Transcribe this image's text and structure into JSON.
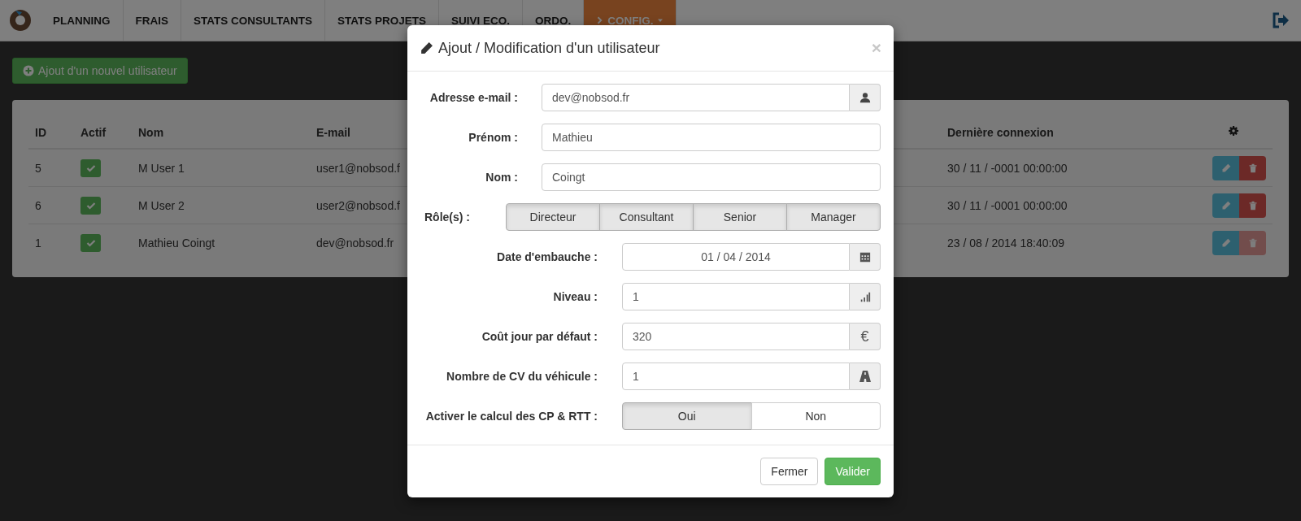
{
  "navbar": {
    "items": [
      {
        "label": "PLANNING",
        "selected": false,
        "dropdown": false
      },
      {
        "label": "FRAIS",
        "selected": false,
        "dropdown": false
      },
      {
        "label": "STATS CONSULTANTS",
        "selected": false,
        "dropdown": false
      },
      {
        "label": "STATS PROJETS",
        "selected": false,
        "dropdown": false
      },
      {
        "label": "SUIVI ECO.",
        "selected": false,
        "dropdown": false
      },
      {
        "label": "ORDO.",
        "selected": false,
        "dropdown": false
      },
      {
        "label": "CONFIG.",
        "selected": true,
        "dropdown": true
      }
    ]
  },
  "add_button": "Ajout d'un nouvel utilisateur",
  "table": {
    "columns": [
      "ID",
      "Actif",
      "Nom",
      "E-mail",
      "Dernière connexion"
    ],
    "rows": [
      {
        "id": "5",
        "active": true,
        "name": "M User 1",
        "email": "user1@nobsod.f",
        "last_login": "30 / 11 / -0001 00:00:00",
        "delete_disabled": false
      },
      {
        "id": "6",
        "active": true,
        "name": "M User 2",
        "email": "user2@nobsod.f",
        "last_login": "30 / 11 / -0001 00:00:00",
        "delete_disabled": false
      },
      {
        "id": "1",
        "active": true,
        "name": "Mathieu Coingt",
        "email": "dev@nobsod.fr",
        "last_login": "23 / 08 / 2014 18:40:09",
        "delete_disabled": true
      }
    ]
  },
  "modal": {
    "title": "Ajout / Modification d'un utilisateur",
    "close": "×",
    "identity_fields": [
      {
        "label": "Adresse e-mail :",
        "value": "dev@nobsod.fr",
        "addon": true
      },
      {
        "label": "Prénom :",
        "value": "Mathieu",
        "addon": false
      },
      {
        "label": "Nom :",
        "value": "Coingt",
        "addon": false
      }
    ],
    "roles": {
      "label": "Rôle(s) :",
      "options": [
        {
          "label": "Directeur",
          "selected": true
        },
        {
          "label": "Consultant",
          "selected": true
        },
        {
          "label": "Senior",
          "selected": true
        },
        {
          "label": "Manager",
          "selected": true
        }
      ]
    },
    "detail_fields": [
      {
        "label": "Date d'embauche :",
        "value": "01 / 04 / 2014",
        "kind": "date"
      },
      {
        "label": "Niveau :",
        "value": "1",
        "kind": "level"
      },
      {
        "label": "Coût jour par défaut :",
        "value": "320",
        "kind": "money",
        "addon_text": "€"
      },
      {
        "label": "Nombre de CV du véhicule :",
        "value": "1",
        "kind": "road"
      }
    ],
    "cp_rtt": {
      "label": "Activer le calcul des CP & RTT :",
      "options": [
        {
          "label": "Oui",
          "selected": true
        },
        {
          "label": "Non",
          "selected": false
        }
      ]
    },
    "buttons": [
      {
        "label": "Fermer",
        "kind": "default"
      },
      {
        "label": "Valider",
        "kind": "primary"
      }
    ]
  }
}
